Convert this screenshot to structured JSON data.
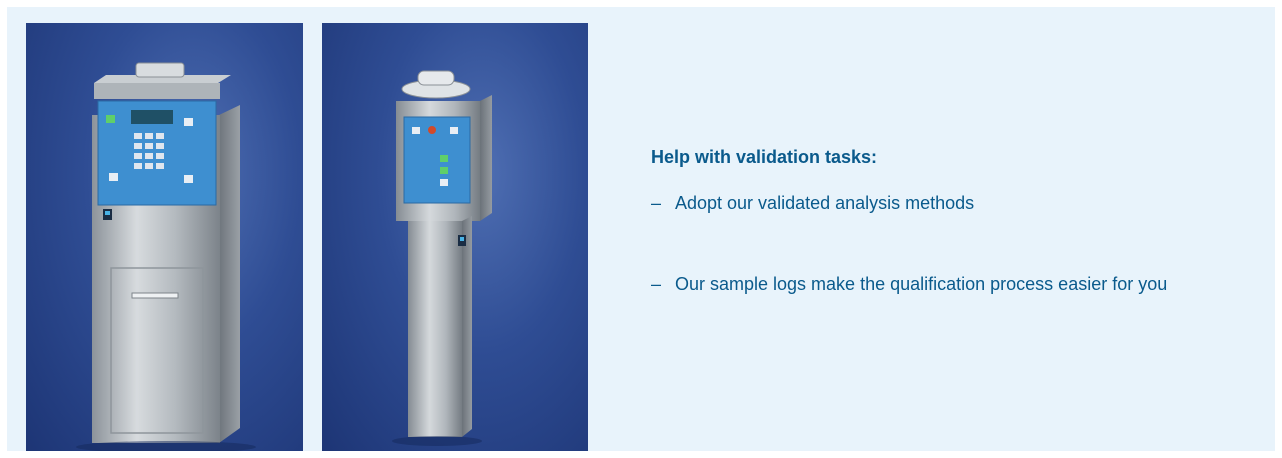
{
  "heading": "Help with validation tasks:",
  "list": {
    "bullet": "–",
    "items": [
      {
        "text": "Adopt our validated analysis methods"
      },
      {
        "text": "Our sample logs make the qualification process easier for you"
      }
    ]
  },
  "images": [
    {
      "name": "stainless steel sampler with keypad control panel"
    },
    {
      "name": "slim stainless steel sampler column with control panel"
    }
  ],
  "colors": {
    "panel_background": "#e8f3fb",
    "text": "#0a5a8c",
    "photo_background": "#2f4d94"
  }
}
